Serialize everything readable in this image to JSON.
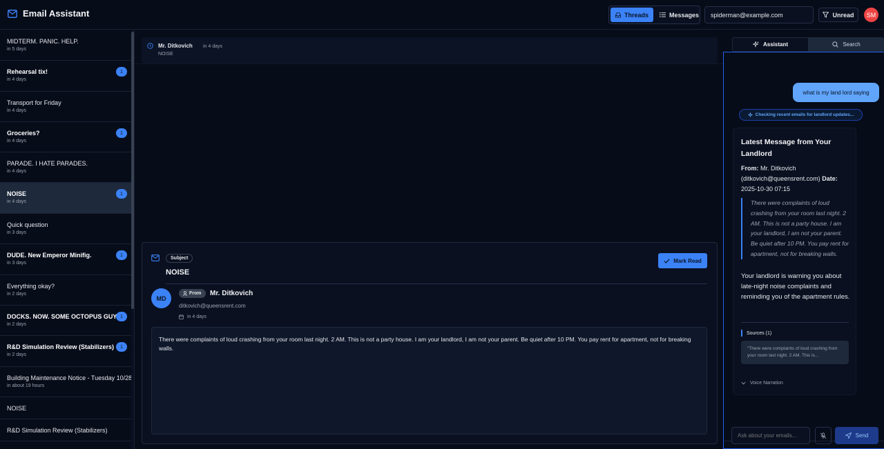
{
  "header": {
    "title": "Email Assistant",
    "view_tabs": [
      "Threads",
      "Messages"
    ],
    "account_email": "spiderman@example.com",
    "filter_label": "Unread",
    "avatar_initials": "SM"
  },
  "threads": [
    {
      "subject": "MIDTERM. PANIC. HELP.",
      "time": "in 5 days",
      "unread": false,
      "badge": ""
    },
    {
      "subject": "Rehearsal tix!",
      "time": "in 4 days",
      "unread": true,
      "badge": "1"
    },
    {
      "subject": "Transport for Friday",
      "time": "in 4 days",
      "unread": false,
      "badge": ""
    },
    {
      "subject": "Groceries?",
      "time": "in 4 days",
      "unread": true,
      "badge": "1"
    },
    {
      "subject": "PARADE. I HATE PARADES.",
      "time": "in 4 days",
      "unread": false,
      "badge": ""
    },
    {
      "subject": "NOISE",
      "time": "in 4 days",
      "unread": true,
      "badge": "1"
    },
    {
      "subject": "Quick question",
      "time": "in 3 days",
      "unread": false,
      "badge": ""
    },
    {
      "subject": "DUDE. New Emperor Minifig.",
      "time": "in 3 days",
      "unread": true,
      "badge": "1"
    },
    {
      "subject": "Everything okay?",
      "time": "in 2 days",
      "unread": false,
      "badge": ""
    },
    {
      "subject": "DOCKS. NOW. SOME OCTOPUS GUY.",
      "time": "in 2 days",
      "unread": true,
      "badge": "1"
    },
    {
      "subject": "R&D Simulation Review (Stabilizers)",
      "time": "in 2 days",
      "unread": true,
      "badge": "1"
    },
    {
      "subject": "Building Maintenance Notice - Tuesday 10/28",
      "time": "in about 19 hours",
      "unread": false,
      "badge": ""
    },
    {
      "subject": "NOISE",
      "time": "",
      "unread": false,
      "badge": ""
    },
    {
      "subject": "R&D Simulation Review (Stabilizers)",
      "time": "",
      "unread": false,
      "badge": ""
    }
  ],
  "selected_thread_index": 5,
  "thread_header": {
    "sender": "Mr. Ditkovich",
    "time": "in 4 days",
    "subject": "NOISE"
  },
  "message": {
    "subject_label": "Subject",
    "subject": "NOISE",
    "mark_read_label": "Mark Read",
    "avatar_initials": "MD",
    "from_label": "From",
    "from_name": "Mr. Ditkovich",
    "from_email": "ditkovich@queensrent.com",
    "date": "in 4 days",
    "body": "There were complaints of loud crashing from your room last night. 2 AM. This is not a party house. I am your landlord, I am not your parent. Be quiet after 10 PM. You pay rent for apartment, not for breaking walls."
  },
  "assistant": {
    "tabs": [
      "Assistant",
      "Search"
    ],
    "user_message": "what is my land lord saying",
    "status": "Checking recent emails for landlord updates...",
    "answer_title": "Latest Message from Your Landlord",
    "from_label": "From:",
    "from_value": "Mr. Ditkovich (ditkovich@queensrent.com)",
    "date_label": "Date:",
    "date_value": "2025-10-30 07:15",
    "quote": "There were complaints of loud crashing from your room last night. 2 AM. This is not a party house. I am your landlord, I am not your parent. Be quiet after 10 PM. You pay rent for apartment, not for breaking walls.",
    "summary": "Your landlord is warning you about late-night noise complaints and reminding you of the apartment rules.",
    "sources_label": "Sources (1)",
    "source_snippet": "\"There were complaints of loud crashing from your room last night. 2 AM. This is...",
    "voice_label": "Voice Narration",
    "input_placeholder": "Ask about your emails...",
    "send_label": "Send"
  },
  "colors": {
    "accent": "#3b82f6",
    "background": "#060b18",
    "avatar": "#ef4444"
  }
}
